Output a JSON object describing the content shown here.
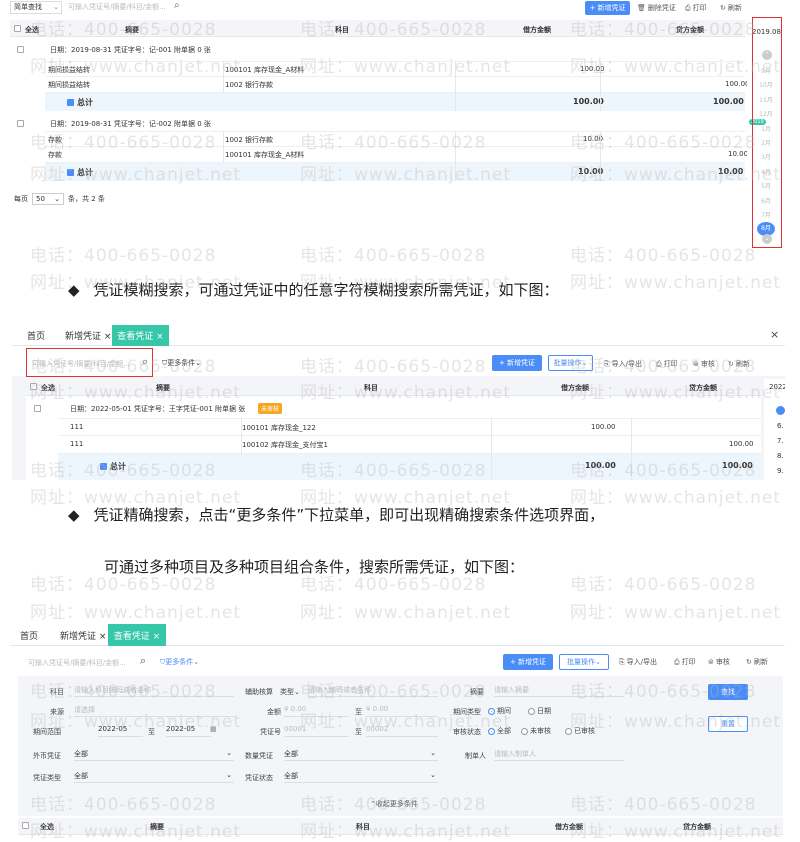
{
  "shot1": {
    "filter_select": "简单查找",
    "search_placeholder": "可输入凭证号/摘要/科目/金额...",
    "new_btn": "+ 新增凭证",
    "delete_btn": "删除凭证",
    "print_btn": "打印",
    "refresh_btn": "刷新",
    "headers": [
      "全选",
      "摘要",
      "科目",
      "借方金额",
      "贷方金额"
    ],
    "vouchers": [
      {
        "meta": "日期：2019-08-31    凭证字号：记-001    附单据 0 张",
        "rows": [
          [
            "期间损益结转",
            "100101 库存现金_A材料",
            "100.00",
            ""
          ],
          [
            "期间损益结转",
            "1002 银行存款",
            "",
            "100.00"
          ]
        ],
        "total_label": "总计",
        "total_debit": "100.00",
        "total_credit": "100.00"
      },
      {
        "meta": "日期：2019-08-31    凭证字号：记-002    附单据 0 张",
        "rows": [
          [
            "存款",
            "1002 银行存款",
            "10.00",
            ""
          ],
          [
            "存款",
            "100101 库存现金_A材料",
            "",
            "10.00"
          ]
        ],
        "total_label": "总计",
        "total_debit": "10.00",
        "total_credit": "10.00"
      }
    ],
    "pagination": [
      "每页",
      "50",
      "条，共 2 条"
    ],
    "year": "2019.08",
    "months": [
      "9月",
      "10月",
      "11月",
      "12月",
      "1月",
      "2月",
      "3月",
      "4月",
      "5月",
      "6月",
      "7月",
      "8月"
    ],
    "year_badge": "2019",
    "active_month": "8月"
  },
  "bullet1": "凭证模糊搜索，可通过凭证中的任意字符模糊搜索所需凭证，如下图：",
  "shot2": {
    "tabs": [
      "首页",
      "新增凭证 ×",
      "查看凭证 ×"
    ],
    "close": "×",
    "search_placeholder": "可输入凭证号/摘要/科目/金额...",
    "more": "更多条件",
    "new_btn": "+ 新增凭证",
    "batch_btn": "批量操作",
    "import_btn": "导入/导出",
    "print_btn": "打印",
    "audit_btn": "审核",
    "refresh_btn": "刷新",
    "headers": [
      "全选",
      "摘要",
      "科目",
      "借方金额",
      "贷方金额"
    ],
    "meta": "日期：2022-05-01    凭证字号：王字凭证-001    附单据  张",
    "badge": "未审核",
    "rows": [
      [
        "111",
        "100101 库存现金_122",
        "100.00",
        ""
      ],
      [
        "111",
        "100102 库存现金_支付宝1",
        "",
        "100.00"
      ]
    ],
    "total_label": "总计",
    "total_debit": "100.00",
    "total_credit": "100.00",
    "side_year": "2022",
    "side_months": [
      "6.",
      "7.",
      "8.",
      "9."
    ]
  },
  "bullet2_line1": "凭证精确搜索，点击“更多条件”下拉菜单，即可出现精确搜索条件选项界面，",
  "bullet2_line2": "可通过多种项目及多种项目组合条件，搜索所需凭证，如下图：",
  "shot3": {
    "tabs": [
      "首页",
      "新增凭证 ×",
      "查看凭证 ×"
    ],
    "search_placeholder": "可输入凭证号/摘要/科目/金额...",
    "more": "更多条件",
    "new_btn": "+ 新增凭证",
    "batch_btn": "批量操作",
    "import_btn": "导入/导出",
    "print_btn": "打印",
    "audit_btn": "审核",
    "refresh_btn": "刷新",
    "f_subject": "科目",
    "f_subject_ph": "请输入科目编码或者名称",
    "f_aux": "辅助核算",
    "f_aux_type": "类型",
    "f_aux_ph": "请输入编码或者名称",
    "f_summary": "摘要",
    "f_summary_ph": "请输入摘要",
    "f_source": "来源",
    "f_source_ph": "请选择",
    "f_amount": "金额",
    "f_amount_from": "¥ 0.00",
    "f_to": "至",
    "f_amount_to": "¥ 0.00",
    "f_period_type": "期间类型",
    "f_period_opt1": "期间",
    "f_period_opt2": "日期",
    "f_period_range": "期间范围",
    "f_period_from": "2022-05",
    "f_period_to": "2022-05",
    "f_vno": "凭证号",
    "f_vno_from": "00001",
    "f_vno_to": "00002",
    "f_audit": "审核状态",
    "f_audit_opts": [
      "全部",
      "未审核",
      "已审核"
    ],
    "f_fx": "外币凭证",
    "f_fx_val": "全部",
    "f_qty": "数量凭证",
    "f_qty_val": "全部",
    "f_maker": "制单人",
    "f_maker_ph": "请输入制单人",
    "f_vtype": "凭证类型",
    "f_vtype_val": "全部",
    "f_vstatus": "凭证状态",
    "f_vstatus_val": "全部",
    "search_btn": "查找",
    "reset_btn": "重置",
    "collapse": "收起更多条件",
    "headers": [
      "全选",
      "摘要",
      "科目",
      "借方金额",
      "贷方金额"
    ]
  },
  "watermark": {
    "phone": "电话：400-665-0028",
    "site": "网址：www.chanjet.net"
  }
}
